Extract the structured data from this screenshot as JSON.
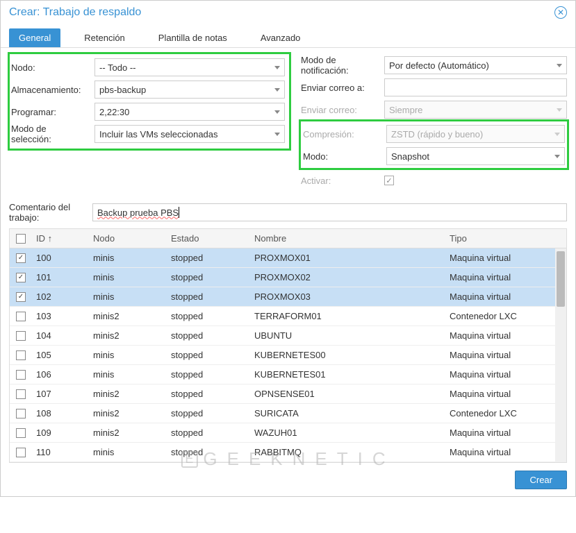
{
  "titlebar": {
    "title": "Crear: Trabajo de respaldo"
  },
  "tabs": {
    "general": "General",
    "retencion": "Retención",
    "plantilla": "Plantilla de notas",
    "avanzado": "Avanzado"
  },
  "left": {
    "nodo_label": "Nodo:",
    "nodo_value": "-- Todo --",
    "alm_label": "Almacenamiento:",
    "alm_value": "pbs-backup",
    "prog_label": "Programar:",
    "prog_value": "2,22:30",
    "modo_label1": "Modo de",
    "modo_label2": "selección:",
    "modo_value": "Incluir las VMs seleccionadas"
  },
  "right": {
    "notif_label1": "Modo de",
    "notif_label2": "notificación:",
    "notif_value": "Por defecto (Automático)",
    "email_label": "Enviar correo a:",
    "email_value": "",
    "enviar_label": "Enviar correo:",
    "enviar_value": "Siempre",
    "compr_label": "Compresión:",
    "compr_value": "ZSTD (rápido y bueno)",
    "modo_label": "Modo:",
    "modo_value": "Snapshot",
    "activar_label": "Activar:"
  },
  "comment": {
    "label1": "Comentario del",
    "label2": "trabajo:",
    "value": "Backup prueba PBS"
  },
  "table": {
    "h_id": "ID ↑",
    "h_nodo": "Nodo",
    "h_estado": "Estado",
    "h_nombre": "Nombre",
    "h_tipo": "Tipo",
    "rows": [
      {
        "checked": true,
        "id": "100",
        "nodo": "minis",
        "estado": "stopped",
        "nombre": "PROXMOX01",
        "tipo": "Maquina virtual"
      },
      {
        "checked": true,
        "id": "101",
        "nodo": "minis",
        "estado": "stopped",
        "nombre": "PROXMOX02",
        "tipo": "Maquina virtual"
      },
      {
        "checked": true,
        "id": "102",
        "nodo": "minis",
        "estado": "stopped",
        "nombre": "PROXMOX03",
        "tipo": "Maquina virtual"
      },
      {
        "checked": false,
        "id": "103",
        "nodo": "minis2",
        "estado": "stopped",
        "nombre": "TERRAFORM01",
        "tipo": "Contenedor LXC"
      },
      {
        "checked": false,
        "id": "104",
        "nodo": "minis2",
        "estado": "stopped",
        "nombre": "UBUNTU",
        "tipo": "Maquina virtual"
      },
      {
        "checked": false,
        "id": "105",
        "nodo": "minis",
        "estado": "stopped",
        "nombre": "KUBERNETES00",
        "tipo": "Maquina virtual"
      },
      {
        "checked": false,
        "id": "106",
        "nodo": "minis",
        "estado": "stopped",
        "nombre": "KUBERNETES01",
        "tipo": "Maquina virtual"
      },
      {
        "checked": false,
        "id": "107",
        "nodo": "minis2",
        "estado": "stopped",
        "nombre": "OPNSENSE01",
        "tipo": "Maquina virtual"
      },
      {
        "checked": false,
        "id": "108",
        "nodo": "minis2",
        "estado": "stopped",
        "nombre": "SURICATA",
        "tipo": "Contenedor LXC"
      },
      {
        "checked": false,
        "id": "109",
        "nodo": "minis2",
        "estado": "stopped",
        "nombre": "WAZUH01",
        "tipo": "Maquina virtual"
      },
      {
        "checked": false,
        "id": "110",
        "nodo": "minis",
        "estado": "stopped",
        "nombre": "RABBITMQ",
        "tipo": "Maquina virtual"
      }
    ]
  },
  "footer": {
    "crear": "Crear"
  },
  "watermark": "GEEKNETIC"
}
